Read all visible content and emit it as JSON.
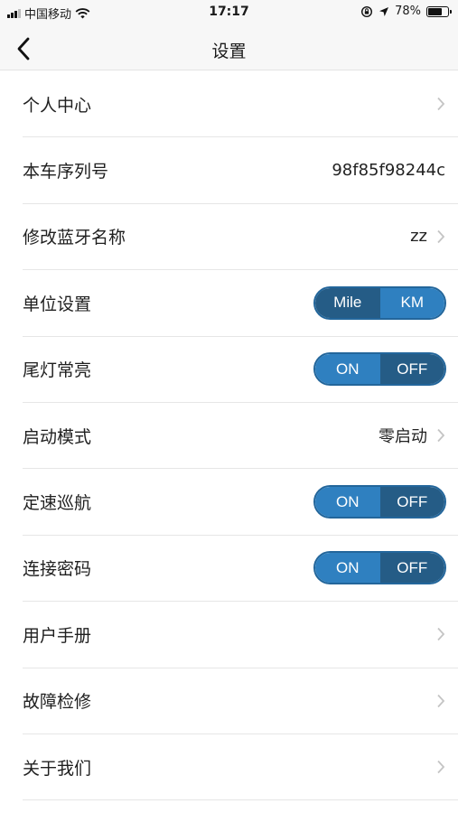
{
  "status_bar": {
    "carrier": "中国移动",
    "time": "17:17",
    "battery": "78%",
    "battery_level": 0.78
  },
  "nav": {
    "title": "设置",
    "back_icon": "chevron-left-icon"
  },
  "rows": [
    {
      "label": "个人中心",
      "value": "",
      "chevron": true
    },
    {
      "label": "本车序列号",
      "value": "98f85f98244c"
    },
    {
      "label": "修改蓝牙名称",
      "value": "zz",
      "chevron": true
    },
    {
      "label": "单位设置",
      "toggle": {
        "left": "Mile",
        "right": "KM",
        "selected": "KM"
      }
    },
    {
      "label": "尾灯常亮",
      "toggle": {
        "left": "ON",
        "right": "OFF",
        "selected": "ON"
      }
    },
    {
      "label": "启动模式",
      "value": "零启动",
      "chevron": true
    },
    {
      "label": "定速巡航",
      "toggle": {
        "left": "ON",
        "right": "OFF",
        "selected": "ON"
      }
    },
    {
      "label": "连接密码",
      "toggle": {
        "left": "ON",
        "right": "OFF",
        "selected": "ON"
      }
    },
    {
      "label": "用户手册",
      "chevron": true
    },
    {
      "label": "故障检修",
      "chevron": true
    },
    {
      "label": "关于我们",
      "chevron": true
    }
  ],
  "colors": {
    "toggle_active": "#2f80c0",
    "toggle_inactive": "#255c86",
    "toggle_border": "#23669b"
  }
}
